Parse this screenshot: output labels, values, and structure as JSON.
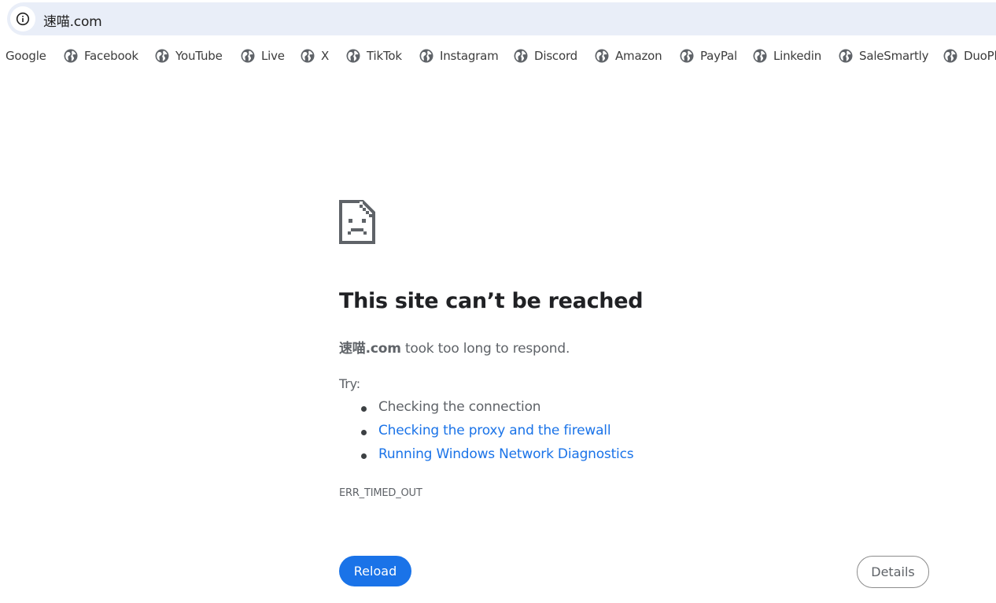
{
  "address_bar": {
    "url": "速喵.com",
    "info_icon": "info-icon"
  },
  "bookmarks": [
    {
      "label": "Google",
      "icon": ""
    },
    {
      "label": "Facebook",
      "icon": "globe-icon"
    },
    {
      "label": "YouTube",
      "icon": "globe-icon"
    },
    {
      "label": "Live",
      "icon": "globe-icon"
    },
    {
      "label": "X",
      "icon": "globe-icon"
    },
    {
      "label": "TikTok",
      "icon": "globe-icon"
    },
    {
      "label": "Instagram",
      "icon": "globe-icon"
    },
    {
      "label": "Discord",
      "icon": "globe-icon"
    },
    {
      "label": "Amazon",
      "icon": "globe-icon"
    },
    {
      "label": "PayPal",
      "icon": "globe-icon"
    },
    {
      "label": "Linkedin",
      "icon": "globe-icon"
    },
    {
      "label": "SaleSmartly",
      "icon": "globe-icon"
    },
    {
      "label": "DuoPl",
      "icon": "globe-icon"
    }
  ],
  "error": {
    "icon": "sad-page-icon",
    "title": "This site can’t be reached",
    "host": "速喵.com",
    "message": " took too long to respond.",
    "try_label": "Try:",
    "suggestions": [
      {
        "text": "Checking the connection",
        "is_link": false
      },
      {
        "text": "Checking the proxy and the firewall",
        "is_link": true
      },
      {
        "text": "Running Windows Network Diagnostics",
        "is_link": true
      }
    ],
    "code": "ERR_TIMED_OUT",
    "reload_label": "Reload",
    "details_label": "Details"
  },
  "colors": {
    "accent": "#1a73e8",
    "omnibox_bg": "#e9eef8",
    "text_dark": "#202124",
    "text_muted": "#5f6368"
  }
}
